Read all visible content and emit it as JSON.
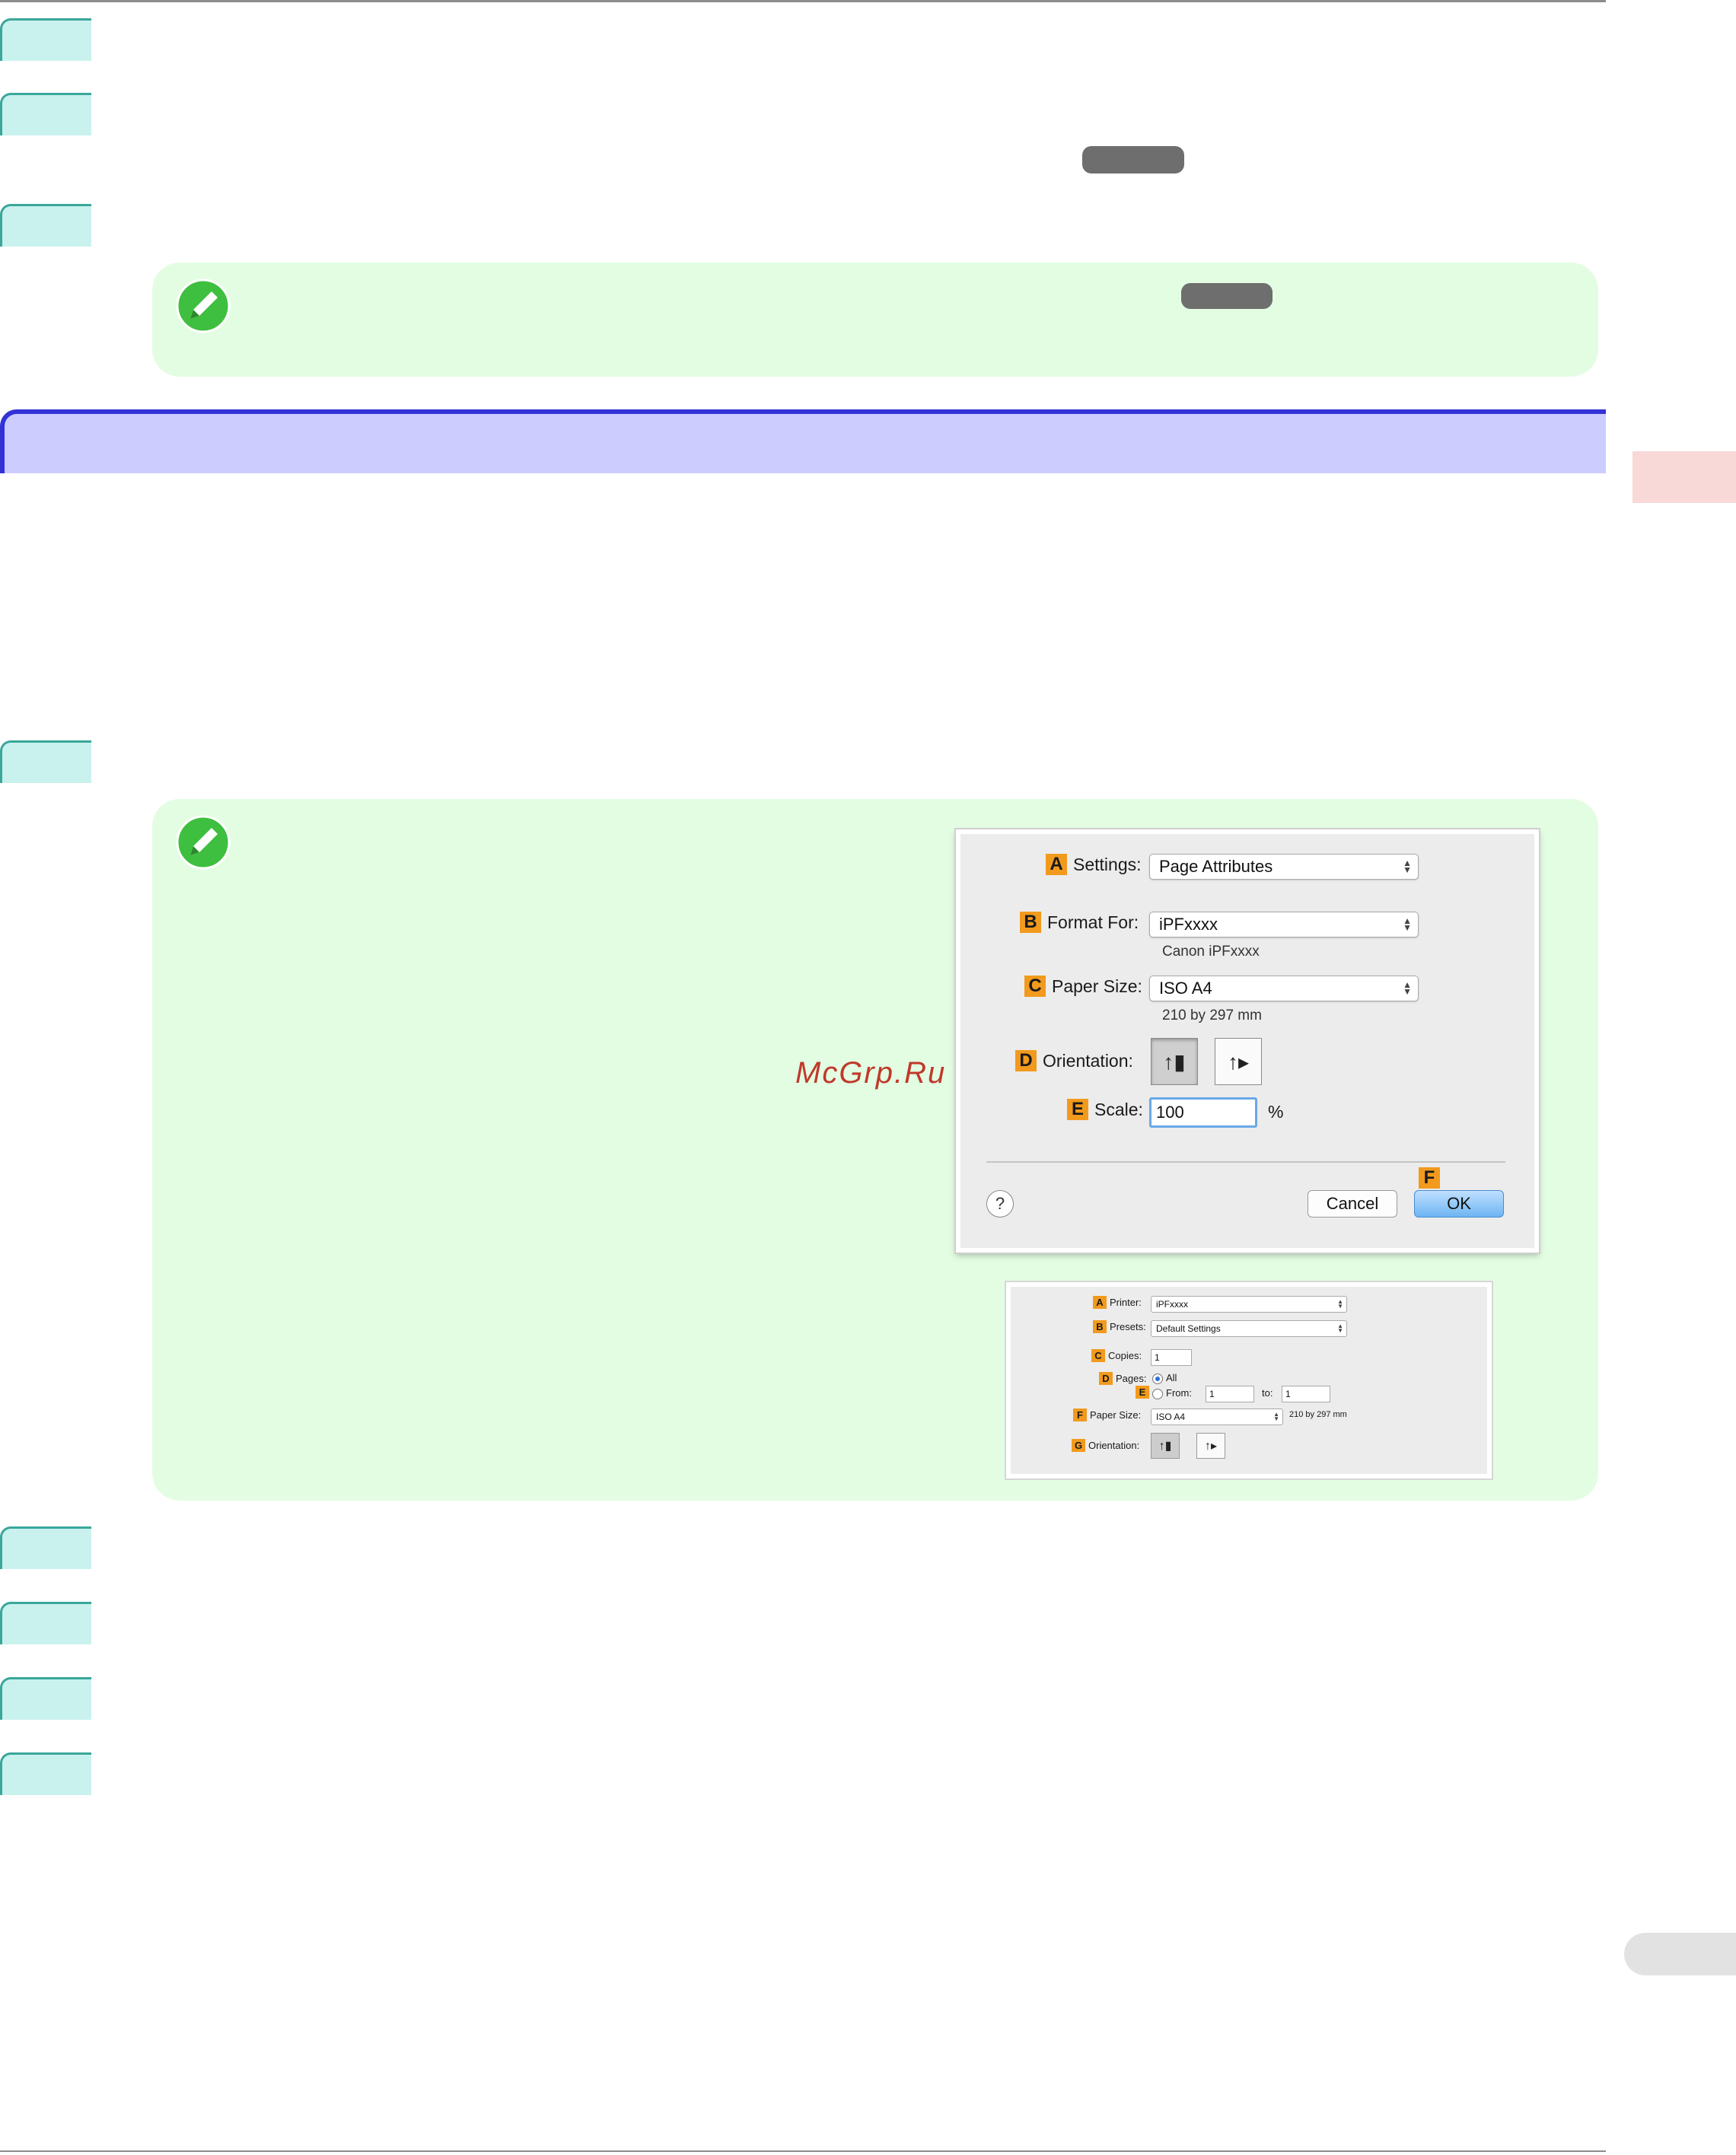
{
  "watermark": "McGrp.Ru",
  "dialog1": {
    "settings": {
      "badge": "A",
      "label": "Settings:",
      "value": "Page Attributes"
    },
    "format_for": {
      "badge": "B",
      "label": "Format For:",
      "value": "iPFxxxx",
      "subtext": "Canon iPFxxxx"
    },
    "paper_size": {
      "badge": "C",
      "label": "Paper Size:",
      "value": "ISO A4",
      "subtext": "210 by 297 mm"
    },
    "orientation": {
      "badge": "D",
      "label": "Orientation:"
    },
    "scale": {
      "badge": "E",
      "label": "Scale:",
      "value": "100",
      "unit": "%"
    },
    "ok_badge": "F",
    "help_glyph": "?",
    "cancel_label": "Cancel",
    "ok_label": "OK"
  },
  "dialog2": {
    "printer": {
      "badge": "A",
      "label": "Printer:",
      "value": "iPFxxxx"
    },
    "presets": {
      "badge": "B",
      "label": "Presets:",
      "value": "Default Settings"
    },
    "copies": {
      "badge": "C",
      "label": "Copies:",
      "value": "1"
    },
    "pages": {
      "badge": "D",
      "label": "Pages:",
      "all_label": "All"
    },
    "range": {
      "badge": "E",
      "from_label": "From:",
      "from_value": "1",
      "to_label": "to:",
      "to_value": "1"
    },
    "paper_size": {
      "badge": "F",
      "label": "Paper Size:",
      "value": "ISO A4",
      "subtext": "210 by 297 mm"
    },
    "orientation": {
      "badge": "G",
      "label": "Orientation:"
    }
  },
  "icons": {
    "note": "pencil-note-icon",
    "portrait": "portrait-orientation-icon",
    "landscape": "landscape-orientation-icon"
  },
  "colors": {
    "step_tab": "#c9f2ee",
    "note_bg": "#e3fde3",
    "section_header": "#ccccff",
    "badge": "#f29a1d",
    "ok_button": "#6fb5f3"
  }
}
